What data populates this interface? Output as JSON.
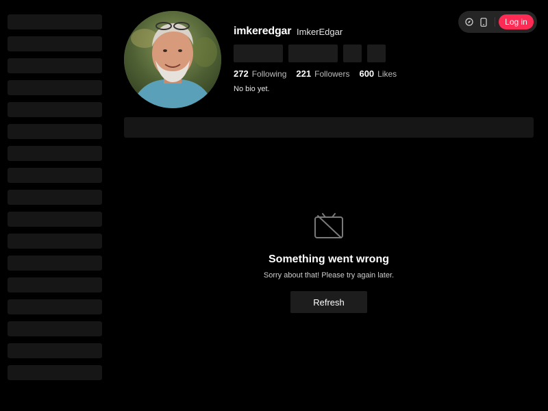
{
  "header": {
    "login_label": "Log in",
    "icons": [
      "compass-icon",
      "phone-icon"
    ],
    "accent_color": "#fe2c55"
  },
  "profile": {
    "username": "imkeredgar",
    "nickname": "ImkerEdgar",
    "stats": [
      {
        "value": "272",
        "label": "Following"
      },
      {
        "value": "221",
        "label": "Followers"
      },
      {
        "value": "600",
        "label": "Likes"
      }
    ],
    "bio": "No bio yet."
  },
  "error": {
    "icon": "broken-screen-icon",
    "title": "Something went wrong",
    "subtitle": "Sorry about that! Please try again later.",
    "refresh_label": "Refresh"
  }
}
